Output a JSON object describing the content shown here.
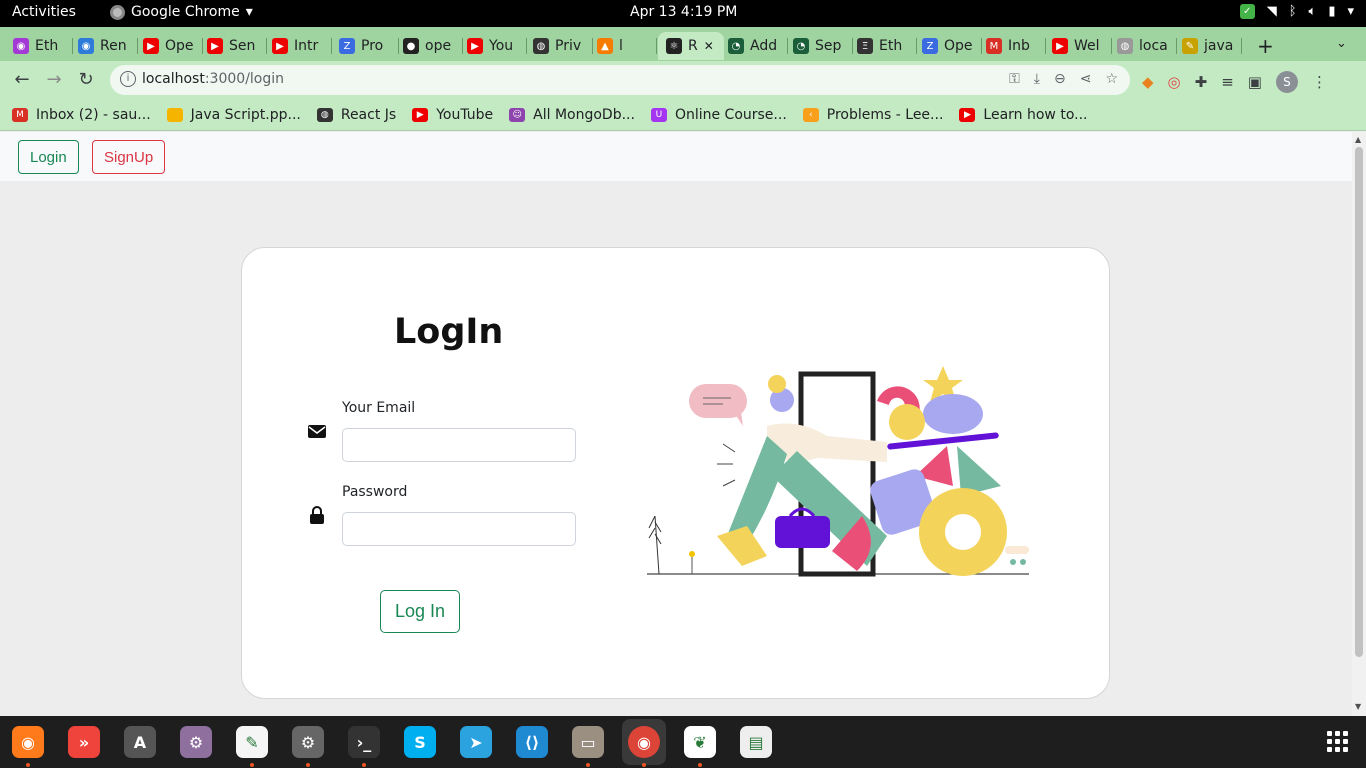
{
  "system": {
    "activities": "Activities",
    "app_name": "Google Chrome",
    "clock": "Apr 13  4:19 PM"
  },
  "tabs": [
    {
      "label": "Eth",
      "icon": "app-circle-icon",
      "color": "#a33ad6"
    },
    {
      "label": "Ren",
      "icon": "app-circle-icon",
      "color": "#2f7bd9"
    },
    {
      "label": "Ope",
      "icon": "youtube-icon",
      "color": "#e00"
    },
    {
      "label": "Sen",
      "icon": "youtube-icon",
      "color": "#e00"
    },
    {
      "label": "Intr",
      "icon": "youtube-icon",
      "color": "#e00"
    },
    {
      "label": "Pro",
      "icon": "zoho-icon",
      "color": "#3b6be0"
    },
    {
      "label": "ope",
      "icon": "github-icon",
      "color": "#222"
    },
    {
      "label": "You",
      "icon": "youtube-icon",
      "color": "#e00"
    },
    {
      "label": "Priv",
      "icon": "globe-icon",
      "color": "#333"
    },
    {
      "label": "l",
      "icon": "fire-icon",
      "color": "#f57c00"
    },
    {
      "label": "R",
      "icon": "react-icon",
      "color": "#222",
      "active": true
    },
    {
      "label": "Add",
      "icon": "chart-icon",
      "color": "#1b5e3a"
    },
    {
      "label": "Sep",
      "icon": "chart-icon",
      "color": "#1b5e3a"
    },
    {
      "label": "Eth",
      "icon": "etherscan-icon",
      "color": "#333"
    },
    {
      "label": "Ope",
      "icon": "zoho-icon",
      "color": "#3b6be0"
    },
    {
      "label": "Inb",
      "icon": "gmail-icon",
      "color": "#d93025"
    },
    {
      "label": "Wel",
      "icon": "youtube-icon",
      "color": "#e00"
    },
    {
      "label": "loca",
      "icon": "globe-icon",
      "color": "#999"
    },
    {
      "label": "java",
      "icon": "js-icon",
      "color": "#c8a200"
    }
  ],
  "toolbar": {
    "url_host": "localhost",
    "url_path": ":3000/login"
  },
  "bookmarks": [
    {
      "label": "Inbox (2) - sau...",
      "icon": "gmail-icon",
      "color": "#d93025"
    },
    {
      "label": "Java Script.pp...",
      "icon": "slides-icon",
      "color": "#f4b400"
    },
    {
      "label": "React Js",
      "icon": "globe-icon",
      "color": "#333"
    },
    {
      "label": "YouTube",
      "icon": "youtube-icon",
      "color": "#e00"
    },
    {
      "label": "All MongoDb...",
      "icon": "avatar-icon",
      "color": "#8e44ad"
    },
    {
      "label": "Online Course...",
      "icon": "udemy-icon",
      "color": "#a435f0"
    },
    {
      "label": "Problems - Lee...",
      "icon": "leetcode-icon",
      "color": "#f89f1b"
    },
    {
      "label": "Learn how to...",
      "icon": "youtube-icon",
      "color": "#e00"
    }
  ],
  "page": {
    "nav": {
      "login_label": "Login",
      "signup_label": "SignUp"
    },
    "form": {
      "title": "LogIn",
      "email_label": "Your Email",
      "email_value": "",
      "password_label": "Password",
      "password_value": "",
      "submit_label": "Log In"
    },
    "colors": {
      "success": "#198754",
      "danger": "#dc3545"
    }
  },
  "dock": [
    {
      "name": "firefox-icon"
    },
    {
      "name": "anydesk-icon"
    },
    {
      "name": "software-updater-icon"
    },
    {
      "name": "tweaks-icon"
    },
    {
      "name": "text-editor-icon"
    },
    {
      "name": "settings-icon"
    },
    {
      "name": "terminal-icon"
    },
    {
      "name": "skype-icon"
    },
    {
      "name": "telegram-icon"
    },
    {
      "name": "vscode-icon"
    },
    {
      "name": "files-icon"
    },
    {
      "name": "chrome-icon"
    },
    {
      "name": "mongodb-compass-icon"
    },
    {
      "name": "screenshot-icon"
    }
  ]
}
